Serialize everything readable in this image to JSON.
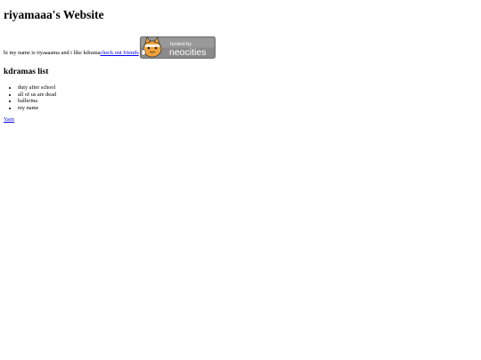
{
  "header": {
    "title": "riyamaaa's Website"
  },
  "intro": {
    "text": "hi my name is riyaaaama and i like kdrama ",
    "link_label": "check out friends"
  },
  "badge": {
    "line1": "hosted by",
    "line2": "neocities",
    "colors": {
      "background": "#8a8a8a",
      "border": "#6d6d6d",
      "text": "#ffffff",
      "cat": "#f2a23a"
    }
  },
  "kdramas": {
    "title": "kdramas list",
    "items": [
      "duty after school",
      "all of us are dead",
      "ballerina",
      "my name"
    ]
  },
  "footer": {
    "link_label": "Yarn"
  }
}
